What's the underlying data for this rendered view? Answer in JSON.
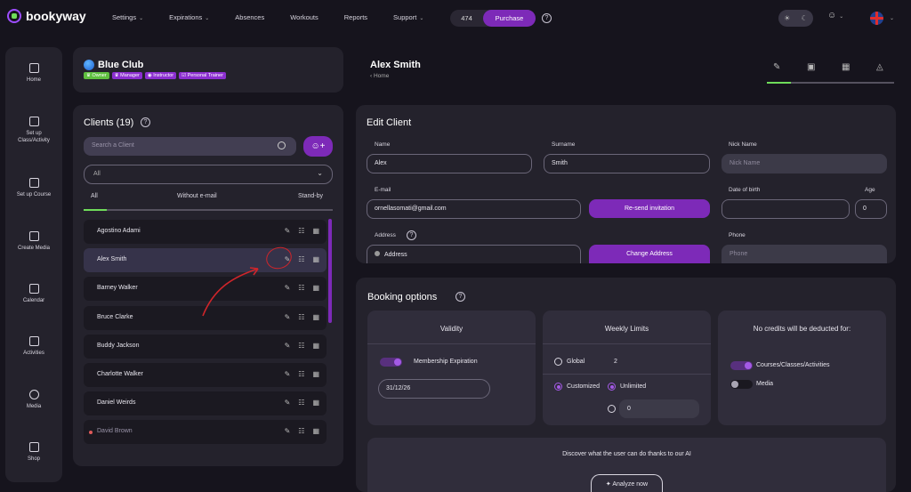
{
  "app": {
    "name": "bookyway"
  },
  "nav": [
    {
      "label": "Settings",
      "dropdown": true
    },
    {
      "label": "Expirations",
      "dropdown": true
    },
    {
      "label": "Absences",
      "dropdown": false
    },
    {
      "label": "Workouts",
      "dropdown": false
    },
    {
      "label": "Reports",
      "dropdown": false
    },
    {
      "label": "Support",
      "dropdown": true
    }
  ],
  "credits": {
    "count": "474",
    "purchase_label": "Purchase"
  },
  "sidebar": [
    {
      "label": "Home",
      "icon": "home-icon"
    },
    {
      "label": "Set up Class/Activity",
      "icon": "edit-square-icon"
    },
    {
      "label": "Set up Course",
      "icon": "course-icon"
    },
    {
      "label": "Create Media",
      "icon": "media-create-icon"
    },
    {
      "label": "Calendar",
      "icon": "calendar-icon"
    },
    {
      "label": "Activities",
      "icon": "document-icon"
    },
    {
      "label": "Media",
      "icon": "play-icon"
    },
    {
      "label": "Shop",
      "icon": "shop-icon"
    }
  ],
  "club": {
    "name": "Blue Club",
    "badges": [
      {
        "label": "Owner",
        "color": "#5fbf3f"
      },
      {
        "label": "Manager",
        "color": "#8c2fd0"
      },
      {
        "label": "Instructor",
        "color": "#8c2fd0"
      },
      {
        "label": "Personal Trainer",
        "color": "#8c2fd0"
      }
    ]
  },
  "clients": {
    "title": "Clients (19)",
    "search_placeholder": "Search a Client",
    "filter_value": "All",
    "tabs": [
      "All",
      "Without e-mail",
      "Stand-by"
    ],
    "list": [
      {
        "name": "Agostino Adami",
        "selected": false,
        "dot": false
      },
      {
        "name": "Alex Smith",
        "selected": true,
        "dot": false
      },
      {
        "name": "Barney Walker",
        "selected": false,
        "dot": false
      },
      {
        "name": "Bruce Clarke",
        "selected": false,
        "dot": false
      },
      {
        "name": "Buddy Jackson",
        "selected": false,
        "dot": false
      },
      {
        "name": "Charlotte Walker",
        "selected": false,
        "dot": false
      },
      {
        "name": "Daniel Weirds",
        "selected": false,
        "dot": false
      },
      {
        "name": "David Brown",
        "selected": false,
        "dot": true
      }
    ]
  },
  "profile": {
    "name": "Alex Smith",
    "breadcrumb": "Home"
  },
  "edit_client": {
    "title": "Edit Client",
    "name_label": "Name",
    "name_value": "Alex",
    "surname_label": "Surname",
    "surname_value": "Smith",
    "nickname_label": "Nick Name",
    "nickname_placeholder": "Nick Name",
    "email_label": "E-mail",
    "email_value": "ornellasomati@gmail.com",
    "resend_label": "Re-send invitation",
    "dob_label": "Date of birth",
    "dob_value": "",
    "age_label": "Age",
    "age_value": "0",
    "address_label": "Address",
    "address_value": "Address",
    "change_address_label": "Change Address",
    "phone_label": "Phone",
    "phone_placeholder": "Phone"
  },
  "booking": {
    "title": "Booking options",
    "validity": {
      "title": "Validity",
      "membership_label": "Membership Expiration",
      "expiration_date": "31/12/26"
    },
    "weekly": {
      "title": "Weekly Limits",
      "global_label": "Global",
      "global_value": "2",
      "customized_label": "Customized",
      "unlimited_label": "Unlimited",
      "custom_value": "0"
    },
    "no_credits": {
      "title": "No credits will be deducted for:",
      "courses_label": "Courses/Classes/Activities",
      "media_label": "Media"
    },
    "ai": {
      "text": "Discover what the user can do thanks to our AI",
      "button_label": "Analyze now"
    }
  },
  "colors": {
    "accent": "#7d2ab8",
    "success": "#6fdc5a",
    "annotation": "#d0252a",
    "background": "#16141d",
    "panel": "#24222c"
  }
}
